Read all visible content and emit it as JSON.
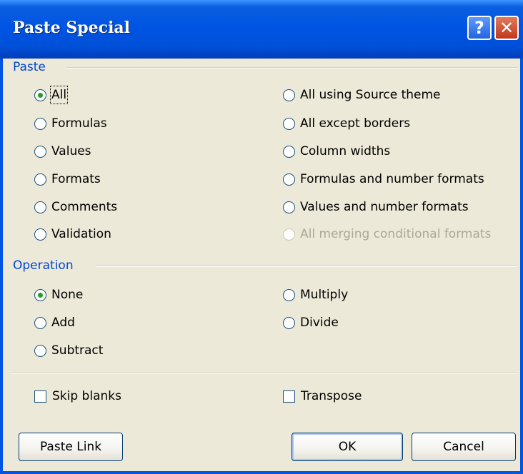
{
  "window": {
    "title": "Paste Special"
  },
  "titlebar_buttons": {
    "help_label": "?",
    "close_label": "✕"
  },
  "paste": {
    "label": "Paste",
    "options": [
      {
        "label": "All",
        "checked": true
      },
      {
        "label": "Formulas",
        "checked": false
      },
      {
        "label": "Values",
        "checked": false
      },
      {
        "label": "Formats",
        "checked": false
      },
      {
        "label": "Comments",
        "checked": false
      },
      {
        "label": "Validation",
        "checked": false
      },
      {
        "label": "All using Source theme",
        "checked": false
      },
      {
        "label": "All except borders",
        "checked": false
      },
      {
        "label": "Column widths",
        "checked": false
      },
      {
        "label": "Formulas and number formats",
        "checked": false
      },
      {
        "label": "Values and number formats",
        "checked": false
      },
      {
        "label": "All merging conditional formats",
        "checked": false,
        "disabled": true
      }
    ]
  },
  "operation": {
    "label": "Operation",
    "options": [
      {
        "label": "None",
        "checked": true
      },
      {
        "label": "Add",
        "checked": false
      },
      {
        "label": "Subtract",
        "checked": false
      },
      {
        "label": "Multiply",
        "checked": false
      },
      {
        "label": "Divide",
        "checked": false
      }
    ]
  },
  "checkboxes": {
    "skip_blanks": {
      "label": "Skip blanks",
      "checked": false
    },
    "transpose": {
      "label": "Transpose",
      "checked": false
    }
  },
  "buttons": {
    "paste_link": "Paste Link",
    "ok": "OK",
    "cancel": "Cancel"
  }
}
